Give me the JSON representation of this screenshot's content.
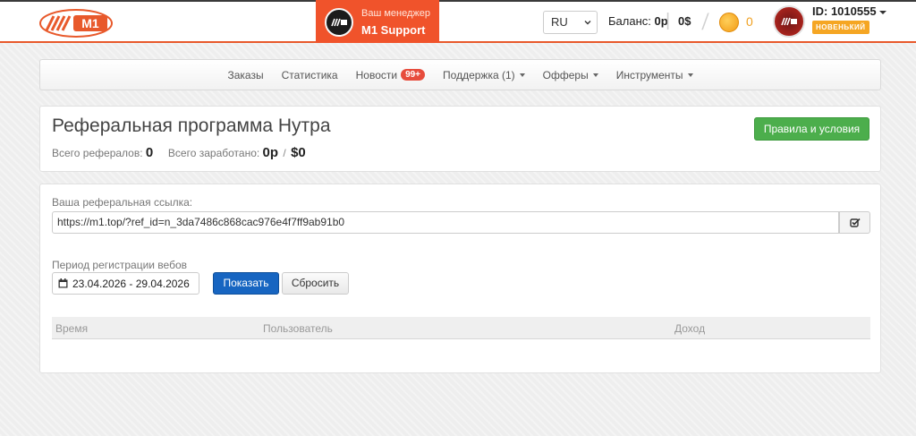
{
  "header": {
    "logo_text": "M1",
    "manager": {
      "label": "Ваш менеджер",
      "name": "M1 Support"
    },
    "language": "RU",
    "balance": {
      "label": "Баланс:",
      "rub": "0р",
      "usd": "0$"
    },
    "coins": "0",
    "user": {
      "id": "ID: 1010555",
      "badge": "НОВЕНЬКИЙ"
    }
  },
  "nav": {
    "items": [
      {
        "label": "Заказы"
      },
      {
        "label": "Статистика"
      },
      {
        "label": "Новости",
        "badge": "99+"
      },
      {
        "label": "Поддержка (1)",
        "dropdown": true
      },
      {
        "label": "Офферы",
        "dropdown": true
      },
      {
        "label": "Инструменты",
        "dropdown": true
      }
    ]
  },
  "page": {
    "title": "Реферальная программа Нутра",
    "stats": {
      "referrals_label": "Всего рефералов:",
      "referrals_value": "0",
      "earned_label": "Всего заработано:",
      "earned_rub": "0р",
      "slash": "/",
      "earned_usd": "$0"
    },
    "rules_button": "Правила и условия"
  },
  "referral": {
    "link_label": "Ваша реферальная ссылка:",
    "link_value": "https://m1.top/?ref_id=n_3da7486c868cac976e4f7ff9ab91b0",
    "period_label": "Период регистрации вебов",
    "date_range": "23.04.2026 - 29.04.2026",
    "show_button": "Показать",
    "reset_button": "Сбросить"
  },
  "table": {
    "columns": [
      "Время",
      "Пользователь",
      "Доход"
    ]
  },
  "colors": {
    "accent": "#f0532b",
    "success": "#4cae4c",
    "primary": "#1765c1"
  }
}
